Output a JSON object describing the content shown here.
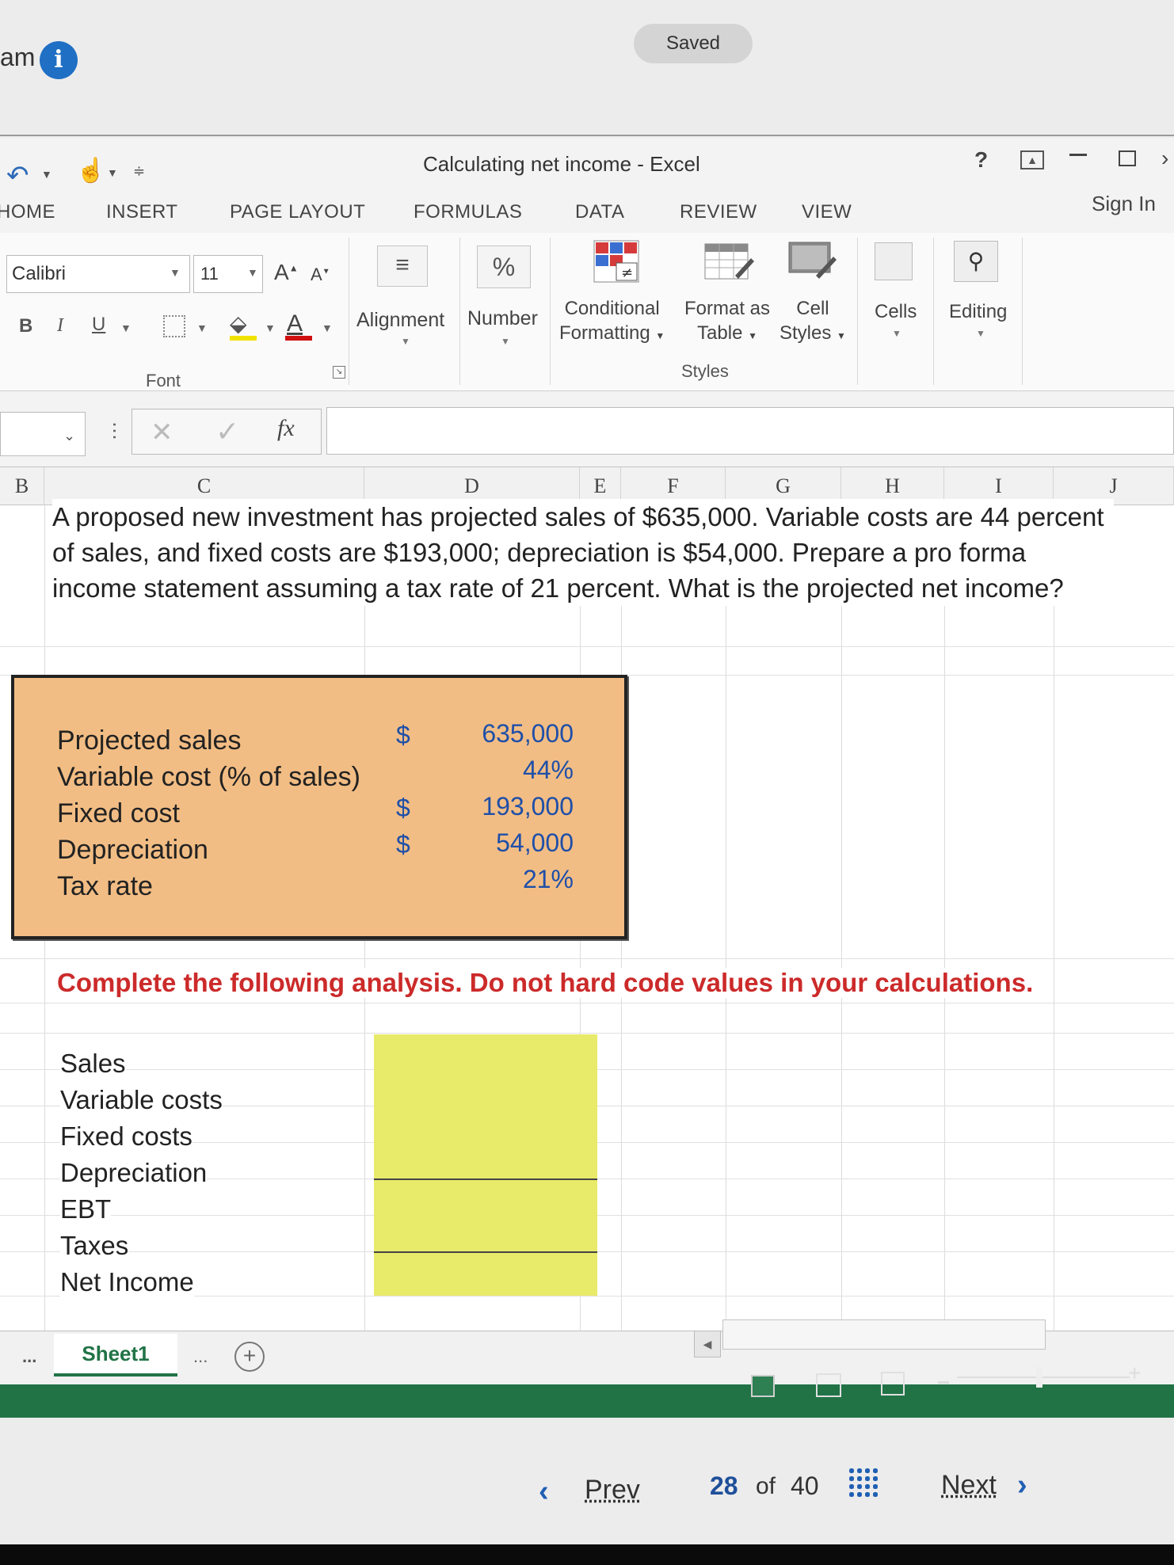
{
  "top": {
    "am_text": "am",
    "saved_label": "Saved"
  },
  "window": {
    "title": "Calculating net income - Excel",
    "help": "?",
    "sign_in": "Sign In"
  },
  "tabs": [
    "HOME",
    "INSERT",
    "PAGE LAYOUT",
    "FORMULAS",
    "DATA",
    "REVIEW",
    "VIEW"
  ],
  "ribbon": {
    "font_name": "Calibri",
    "font_size": "11",
    "bold": "B",
    "italic": "I",
    "underline": "U",
    "font_group": "Font",
    "alignment": "Alignment",
    "number": "Number",
    "number_icon": "%",
    "conditional_formatting": [
      "Conditional",
      "Formatting"
    ],
    "format_as_table": [
      "Format as",
      "Table"
    ],
    "cell_styles": [
      "Cell",
      "Styles"
    ],
    "styles_group": "Styles",
    "cells": "Cells",
    "editing": "Editing"
  },
  "formula_bar": {
    "fx": "fx",
    "value": ""
  },
  "columns": [
    "B",
    "C",
    "D",
    "E",
    "F",
    "G",
    "H",
    "I",
    "J"
  ],
  "sheet": {
    "question": "A proposed new investment has projected sales of $635,000. Variable costs are 44 percent of sales, and fixed costs are $193,000; depreciation is $54,000. Prepare a pro forma income statement assuming a tax rate of 21 percent. What is the projected net income?",
    "given": [
      {
        "label": "Projected sales",
        "dollar": "$",
        "value": "635,000"
      },
      {
        "label": "Variable cost (% of sales)",
        "dollar": "",
        "value": "44%"
      },
      {
        "label": "Fixed cost",
        "dollar": "$",
        "value": "193,000"
      },
      {
        "label": "Depreciation",
        "dollar": "$",
        "value": "54,000"
      },
      {
        "label": "Tax rate",
        "dollar": "",
        "value": "21%"
      }
    ],
    "instruction": "Complete the following analysis. Do not hard code values in your calculations.",
    "analysis_labels": [
      "Sales",
      "Variable costs",
      "Fixed costs",
      "Depreciation",
      "EBT",
      "Taxes",
      "Net Income"
    ]
  },
  "sheet_tabs": {
    "active": "Sheet1",
    "more": "...",
    "add": "+"
  },
  "nav": {
    "prev": "Prev",
    "current": "28",
    "of": "of",
    "total": "40",
    "next": "Next"
  },
  "colors": {
    "excel_green": "#217346",
    "input_fill": "#f2bd84",
    "answer_fill": "#e8ea6a",
    "instruction_red": "#cc2a2a",
    "value_blue": "#1f4fa8"
  }
}
